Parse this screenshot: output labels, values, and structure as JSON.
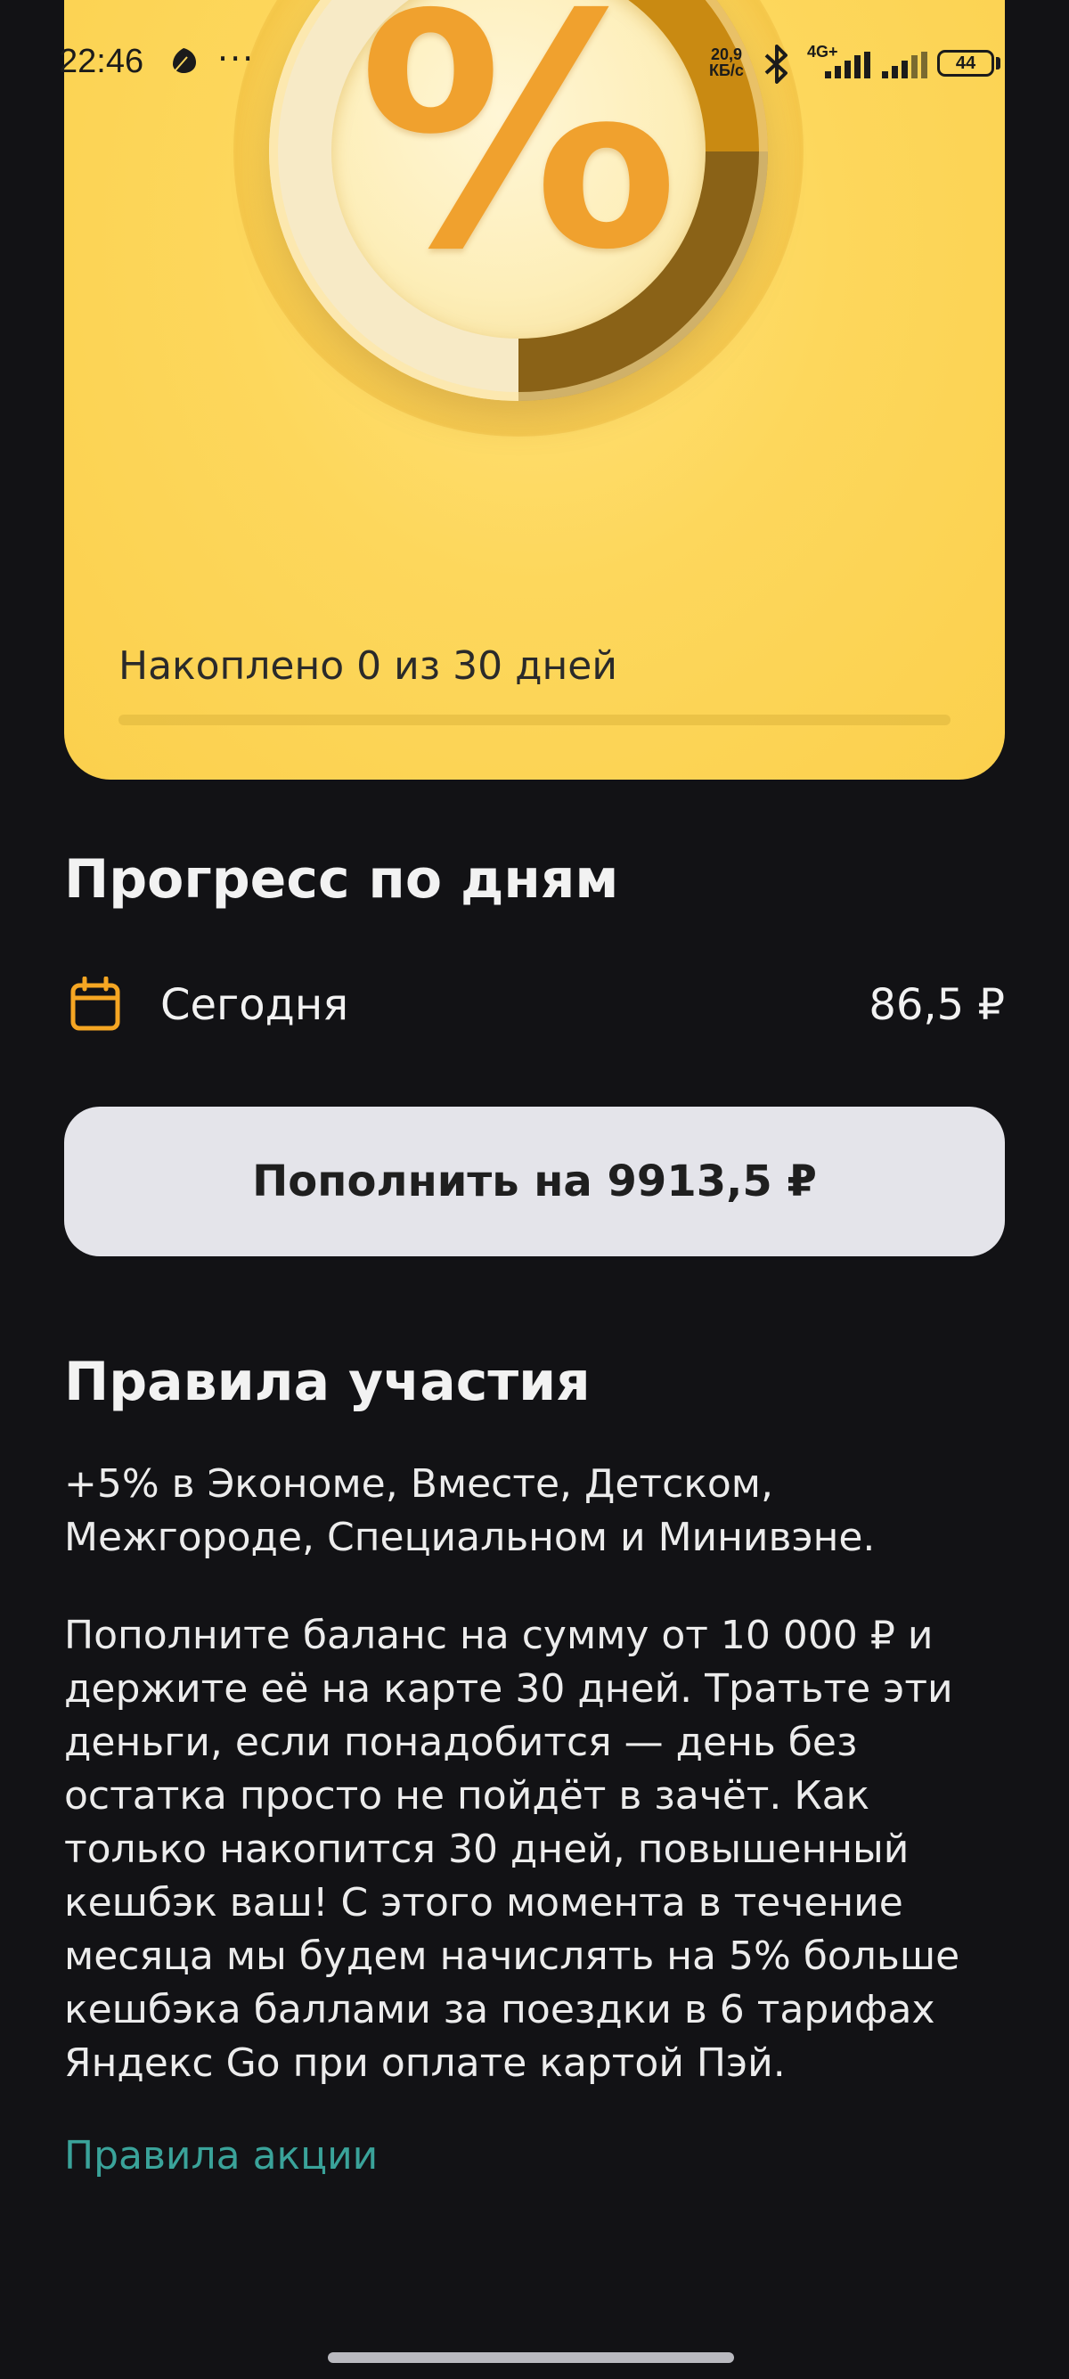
{
  "status_bar": {
    "time": "22:46",
    "dots": "···",
    "speed_value": "20,9",
    "speed_unit": "КБ/с",
    "network": "4G+",
    "battery": "44",
    "icons": [
      "leaf-icon",
      "bluetooth-icon",
      "signal-icon",
      "battery-icon"
    ]
  },
  "hero": {
    "glyph": "%",
    "progress_label": "Накоплено 0 из 30 дней",
    "progress_fraction": 0
  },
  "progress_section": {
    "title": "Прогресс по дням",
    "rows": [
      {
        "icon": "calendar-icon",
        "label": "Сегодня",
        "amount": "86,5 ₽"
      }
    ]
  },
  "topup": {
    "label": "Пополнить на 9913,5 ₽"
  },
  "rules_section": {
    "title": "Правила участия",
    "paragraphs": [
      "+5% в Экономе, Вместе, Детском, Межгороде, Специальном и Минивэне.",
      "Пополните баланс на сумму от 10 000 ₽ и держите её на карте 30 дней. Тратьте эти деньги, если понадобится — день без остатка просто не пойдёт в зачёт. Как только накопится 30 дней, повышенный кешбэк ваш! С этого момента в течение месяца мы будем начислять на 5% больше кешбэка баллами за поездки в 6 тарифах Яндекс Go при оплате картой Пэй."
    ],
    "link": "Правила акции"
  },
  "colors": {
    "background": "#121215",
    "hero_yellow": "#fdd75c",
    "accent_orange": "#f0a12e",
    "button_bg": "#e4e4ea",
    "link_teal": "#3aa39a"
  }
}
